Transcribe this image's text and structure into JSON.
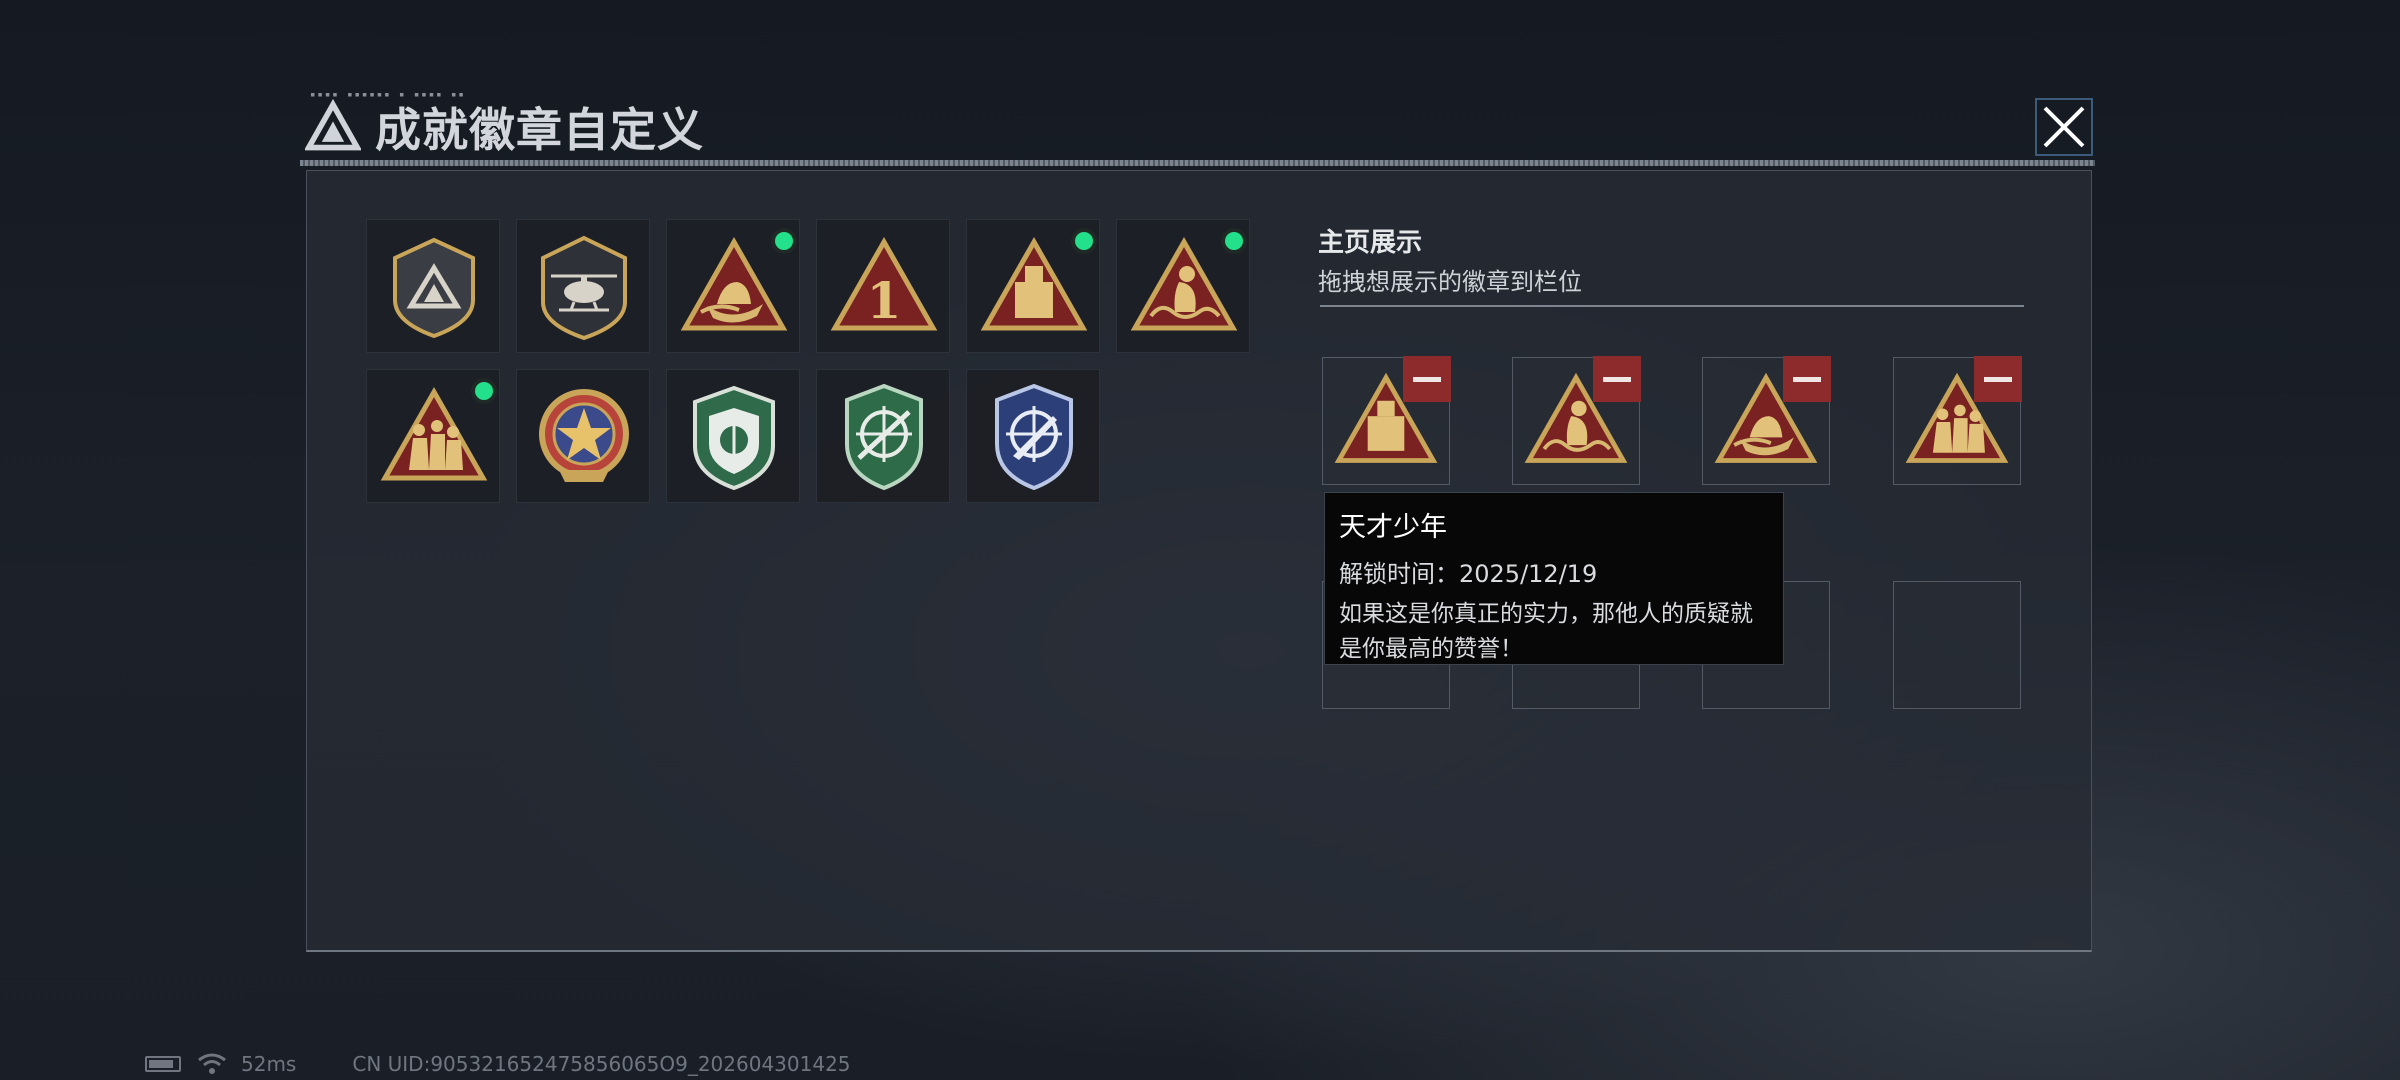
{
  "window": {
    "title": "成就徽章自定义"
  },
  "badges": [
    {
      "name": "shield-delta-badge",
      "is_new": false
    },
    {
      "name": "helicopter-badge",
      "is_new": false
    },
    {
      "name": "boat-triangle-badge",
      "is_new": true
    },
    {
      "name": "number-one-triangle-badge",
      "is_new": false
    },
    {
      "name": "usb-triangle-badge",
      "is_new": true
    },
    {
      "name": "wave-figure-triangle-badge",
      "is_new": true
    },
    {
      "name": "squad-triangle-badge",
      "is_new": true
    },
    {
      "name": "star-medal-badge",
      "is_new": false
    },
    {
      "name": "green-shield-badge",
      "is_new": false
    },
    {
      "name": "crosshair-rifle-badge",
      "is_new": false
    },
    {
      "name": "crosshair-knife-badge",
      "is_new": false
    }
  ],
  "showcase": {
    "title": "主页展示",
    "subtitle": "拖拽想展示的徽章到栏位",
    "slots": [
      {
        "badge": "usb-triangle-badge"
      },
      {
        "badge": "wave-figure-triangle-badge"
      },
      {
        "badge": "boat-triangle-badge"
      },
      {
        "badge": "squad-triangle-badge"
      },
      {
        "badge": null
      },
      {
        "badge": null
      },
      {
        "badge": null
      },
      {
        "badge": null
      }
    ]
  },
  "tooltip": {
    "name": "天才少年",
    "unlock": "解锁时间：2025/12/19",
    "desc_line1": "如果这是你真正的实力，那他人的质疑就",
    "desc_line2": "是你最高的赞誉！"
  },
  "status": {
    "ping": "52ms",
    "uid": "CN UID:905321652475856065O9_202604301425"
  },
  "colors": {
    "accent_new": "#23e08a",
    "remove": "#8c2a2c",
    "gold": "#c9a55a"
  }
}
